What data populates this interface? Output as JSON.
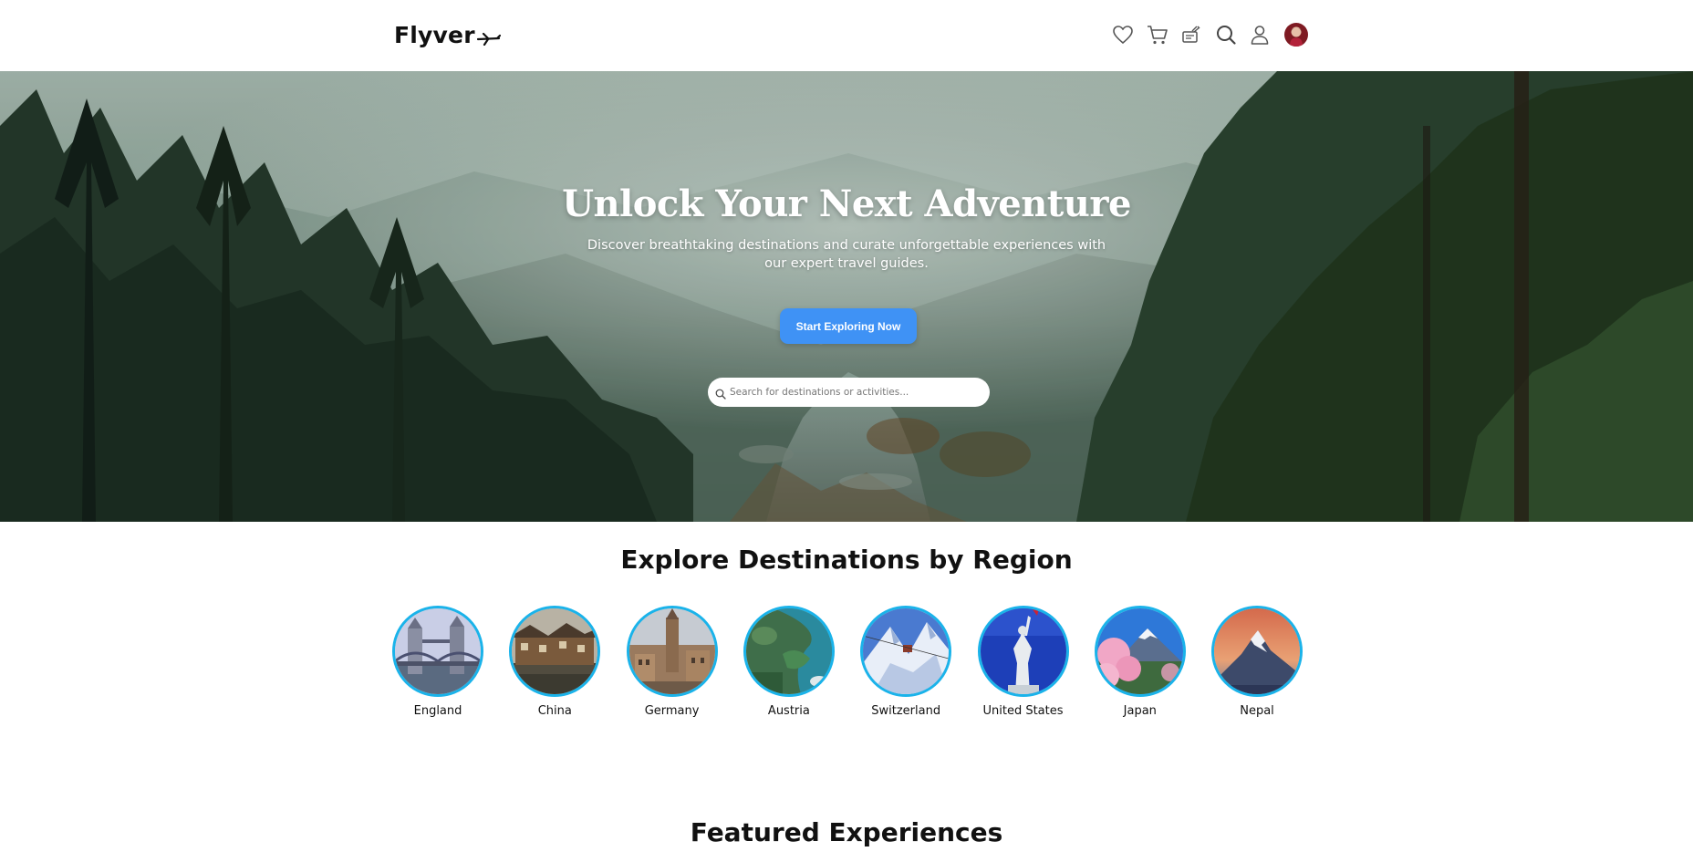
{
  "header": {
    "logo": "Flyver",
    "icons": [
      "heart-icon",
      "cart-icon",
      "tickets-icon",
      "search-icon",
      "user-icon",
      "avatar"
    ]
  },
  "hero": {
    "title": "Unlock Your Next Adventure",
    "subtitle": "Discover breathtaking destinations and curate unforgettable experiences with our expert travel guides.",
    "cta_label": "Start Exploring Now",
    "search_placeholder": "Search for destinations or activities..."
  },
  "regions": {
    "title": "Explore Destinations by Region",
    "items": [
      {
        "name": "England"
      },
      {
        "name": "China"
      },
      {
        "name": "Germany"
      },
      {
        "name": "Austria"
      },
      {
        "name": "Switzerland"
      },
      {
        "name": "United States"
      },
      {
        "name": "Japan"
      },
      {
        "name": "Nepal"
      }
    ]
  },
  "featured": {
    "title": "Featured Experiences"
  },
  "colors": {
    "accent": "#3f92f5",
    "region_ring": "#1ab3ea",
    "text": "#111111"
  }
}
